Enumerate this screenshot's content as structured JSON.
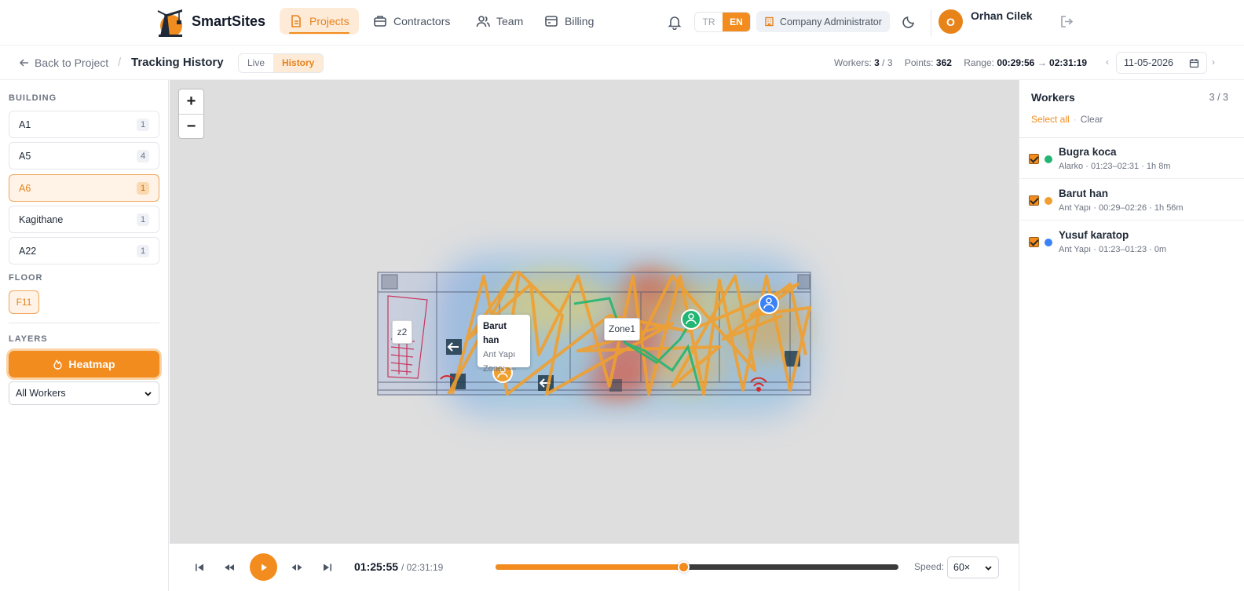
{
  "app": {
    "name": "SmartSites",
    "nav": [
      {
        "label": "Projects",
        "icon": "document-icon",
        "active": true
      },
      {
        "label": "Contractors",
        "icon": "briefcase-icon",
        "active": false
      },
      {
        "label": "Team",
        "icon": "users-icon",
        "active": false
      },
      {
        "label": "Billing",
        "icon": "card-icon",
        "active": false
      }
    ],
    "languages": [
      "TR",
      "EN"
    ],
    "active_language": "EN",
    "role": "Company Administrator",
    "user": {
      "initial": "O",
      "name": "Orhan Cilek"
    }
  },
  "subheader": {
    "back_label": "Back to Project",
    "separator": "/",
    "title": "Tracking History",
    "modes": [
      "Live",
      "History"
    ],
    "active_mode": "History",
    "workers_label": "Workers:",
    "workers_shown": "3",
    "workers_total": "/ 3",
    "points_label": "Points:",
    "points": "362",
    "range_label": "Range:",
    "range_start": "00:29:56",
    "range_arrow": "→",
    "range_end": "02:31:19",
    "date": "11-05-2026",
    "prev": "‹",
    "next": "›"
  },
  "sidebar": {
    "building_label": "BUILDING",
    "buildings": [
      {
        "name": "A1",
        "count": "1"
      },
      {
        "name": "A5",
        "count": "4"
      },
      {
        "name": "A6",
        "count": "1"
      },
      {
        "name": "Kagithane",
        "count": "1"
      },
      {
        "name": "A22",
        "count": "1"
      }
    ],
    "selected_building": "A6",
    "floor_label": "FLOOR",
    "floor": "F11",
    "layers_label": "LAYERS",
    "heatmap_label": "Heatmap",
    "worker_filter": "All Workers"
  },
  "map": {
    "zoom_in": "+",
    "zoom_out": "−",
    "zones": {
      "z2": "z2",
      "zone1": "Zone1"
    },
    "tooltip": {
      "name": "Barut han",
      "company": "Ant Yapı",
      "zone": "Zone: —"
    }
  },
  "playback": {
    "current": "01:25:55",
    "total": "/ 02:31:19",
    "progress": 0.4667,
    "speed_label": "Speed:",
    "speed": "60×"
  },
  "workers_panel": {
    "title": "Workers",
    "count": "3 / 3",
    "select_all": "Select all",
    "dot": "·",
    "clear": "Clear",
    "workers": [
      {
        "name": "Bugra koca",
        "detail": "Alarko · 01:23–02:31 · 1h 8m",
        "color": "#22b573",
        "checked": true
      },
      {
        "name": "Barut han",
        "detail": "Ant Yapı · 00:29–02:26 · 1h 56m",
        "color": "#f0a030",
        "checked": true
      },
      {
        "name": "Yusuf karatop",
        "detail": "Ant Yapı · 01:23–01:23 · 0m",
        "color": "#3b82f6",
        "checked": true
      }
    ]
  },
  "colors": {
    "accent": "#f28c1e",
    "accent_soft": "#fdebd7",
    "path": "#f0a030",
    "green_path": "#22b573",
    "blue_marker": "#3b82f6"
  }
}
